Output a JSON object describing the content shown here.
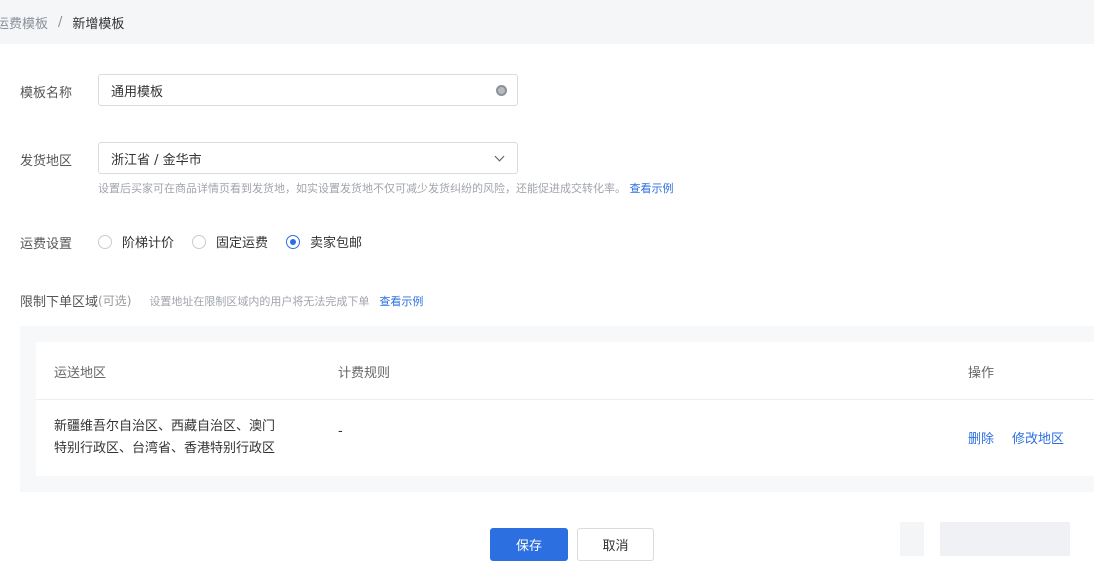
{
  "breadcrumb": {
    "parent": "运费模板",
    "separator": "/",
    "current": "新增模板"
  },
  "form": {
    "template_name": {
      "label": "模板名称",
      "value": "通用模板"
    },
    "ship_from": {
      "label": "发货地区",
      "value": "浙江省 / 金华市",
      "hint": "设置后买家可在商品详情页看到发货地，如实设置发货地不仅可减少发货纠纷的风险，还能促进成交转化率。",
      "hint_link": "查看示例"
    },
    "shipping": {
      "label": "运费设置",
      "options": [
        {
          "label": "阶梯计价",
          "checked": false
        },
        {
          "label": "固定运费",
          "checked": false
        },
        {
          "label": "卖家包邮",
          "checked": true
        }
      ]
    },
    "restrict": {
      "label": "限制下单区域",
      "optional": "(可选)",
      "hint": "设置地址在限制区域内的用户将无法完成下单",
      "hint_link": "查看示例"
    }
  },
  "table": {
    "columns": [
      "运送地区",
      "计费规则",
      "操作"
    ],
    "rows": [
      {
        "area_line1": "新疆维吾尔自治区、西藏自治区、澳门",
        "area_line2": "特别行政区、台湾省、香港特别行政区",
        "rule": "-",
        "actions": [
          "删除",
          "修改地区"
        ]
      }
    ]
  },
  "buttons": {
    "save": "保存",
    "cancel": "取消"
  },
  "colors": {
    "accent": "#2b6fe0",
    "panel_bg": "#f7f8fa",
    "header_bg": "#f5f6f8"
  }
}
